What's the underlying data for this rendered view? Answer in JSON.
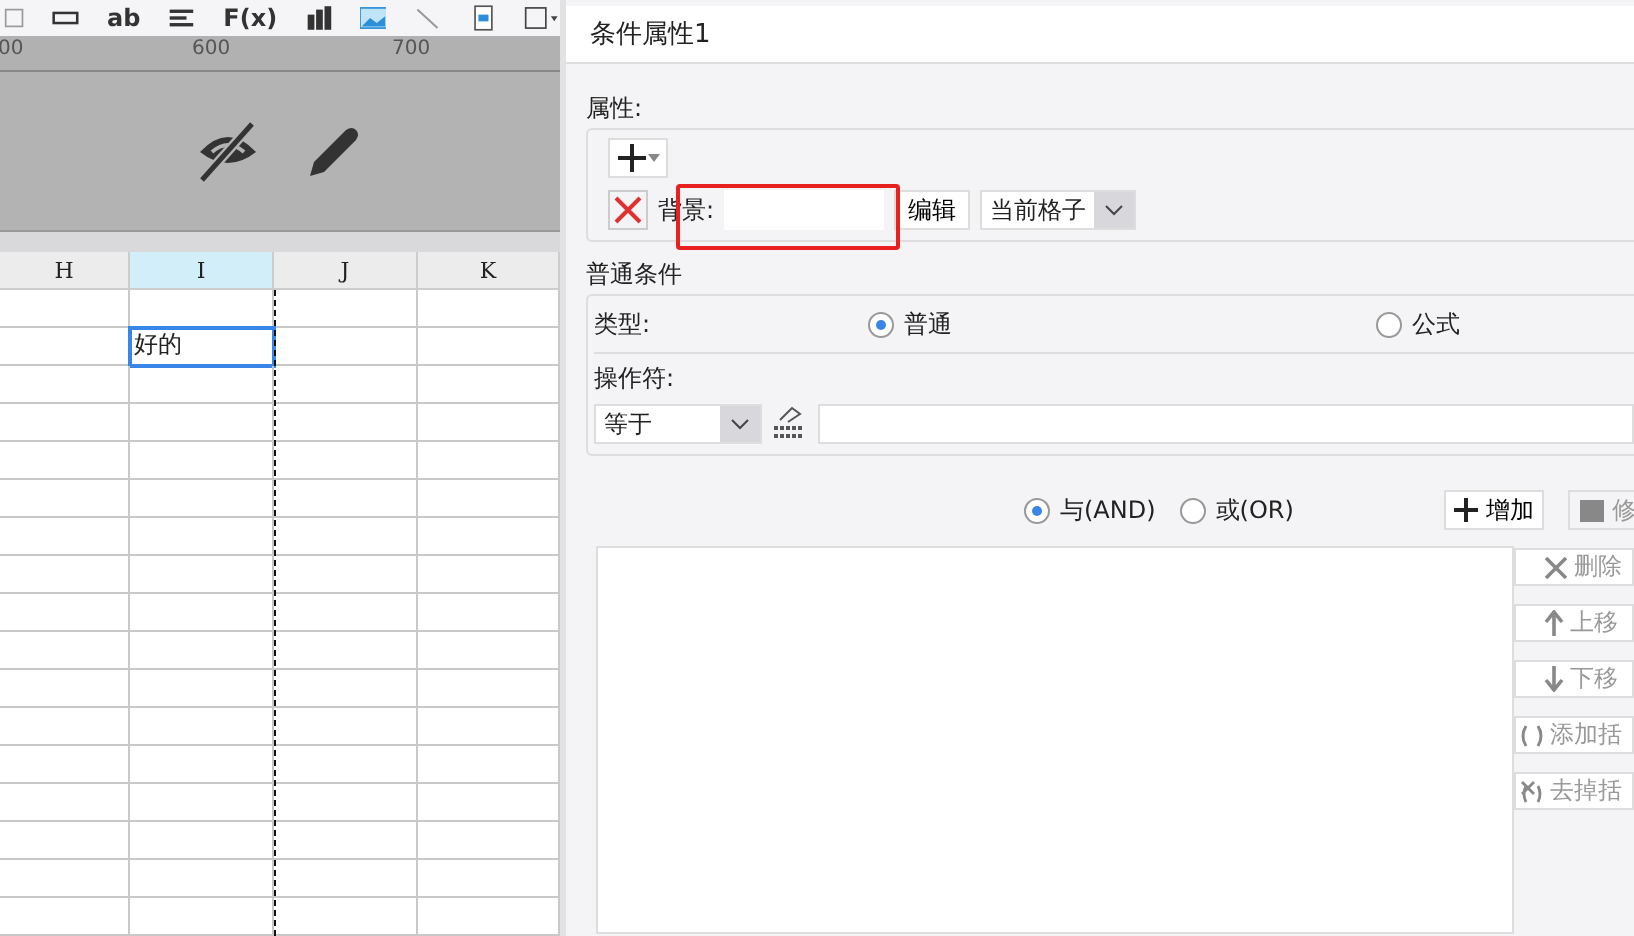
{
  "toolbar": {
    "items": [
      {
        "kind": "table"
      },
      {
        "kind": "textbox"
      },
      {
        "kind": "text",
        "label": "ab"
      },
      {
        "kind": "align"
      },
      {
        "kind": "text",
        "label": "F(x)"
      },
      {
        "kind": "bars"
      },
      {
        "kind": "image"
      },
      {
        "kind": "line"
      },
      {
        "kind": "doc"
      },
      {
        "kind": "border"
      }
    ]
  },
  "ruler": {
    "labels": [
      "00",
      "600",
      "700"
    ]
  },
  "sheet": {
    "columns": [
      {
        "label": "H",
        "selected": false
      },
      {
        "label": "I",
        "selected": true
      },
      {
        "label": "J",
        "selected": false
      },
      {
        "label": "K",
        "selected": false
      }
    ],
    "cells": [
      {
        "text": "好的",
        "selected": true
      }
    ]
  },
  "panel": {
    "title": "条件属性1",
    "attributes": {
      "legend": "属性:",
      "row": {
        "label": "背景:",
        "edit": "编辑",
        "scope": "当前格子"
      }
    },
    "condition": {
      "legend": "普通条件",
      "type_label": "类型:",
      "types": [
        {
          "label": "普通",
          "selected": true
        },
        {
          "label": "公式",
          "selected": false
        }
      ],
      "operator_label": "操作符:",
      "operator": "等于"
    },
    "logic": [
      {
        "label": "与(AND)",
        "selected": true
      },
      {
        "label": "或(OR)",
        "selected": false
      }
    ],
    "add": "增加",
    "modify": "修",
    "side_buttons": [
      {
        "kind": "delete",
        "label": "删除"
      },
      {
        "kind": "up",
        "label": "上移"
      },
      {
        "kind": "down",
        "label": "下移"
      },
      {
        "kind": "paren",
        "label": "添加括"
      },
      {
        "kind": "unparen",
        "label": "去掉括"
      }
    ]
  }
}
